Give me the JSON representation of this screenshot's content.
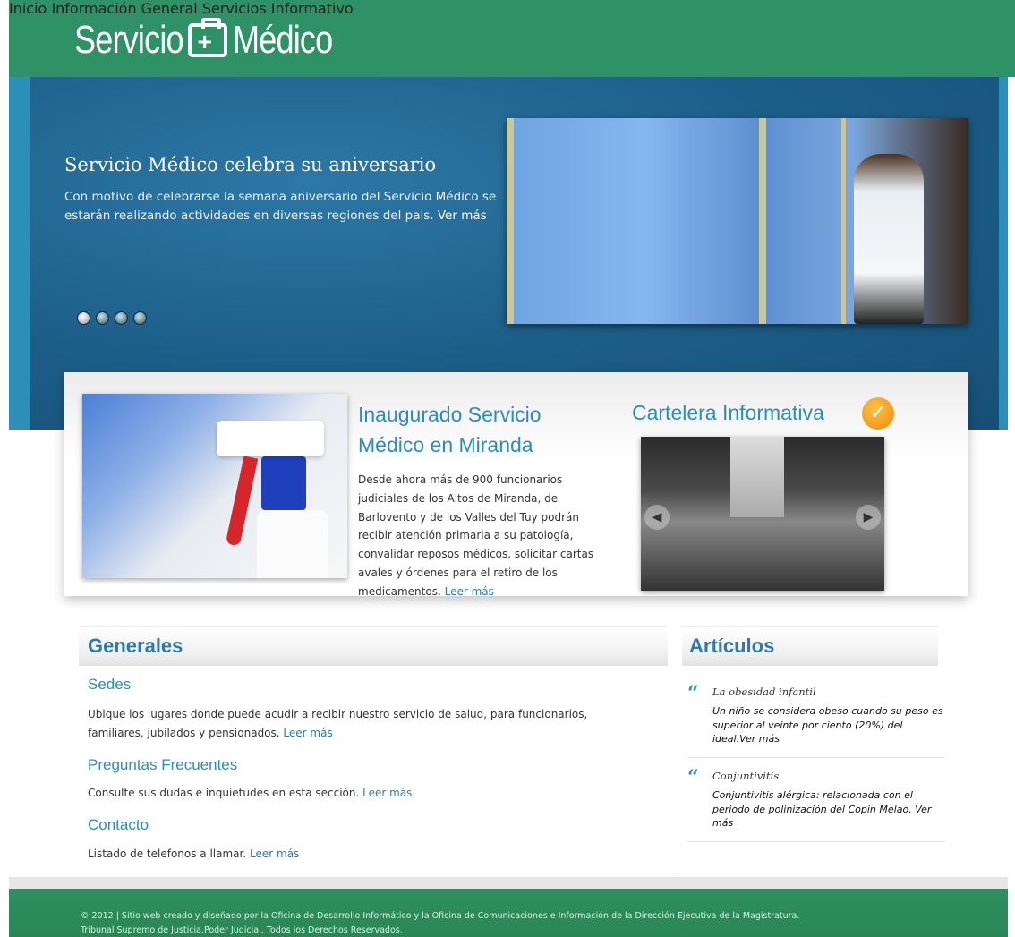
{
  "header": {
    "logo_part1": "Servicio",
    "logo_part2": "Médico",
    "nav": [
      "Inicio",
      "Información General",
      "Servicios",
      "Informativo"
    ]
  },
  "hero": {
    "title": "Servicio Médico celebra su aniversario",
    "text": "Con motivo de celebrarse la semana aniversario del Servicio Médico se estarán realizando actividades en diversas regiones del pais.",
    "more": "Ver más",
    "slides": 4,
    "active_slide": 1
  },
  "featured": {
    "title": "Inaugurado Servicio Médico en Miranda",
    "text": "Desde ahora más de 900 funcionarios judiciales de los Altos de Miranda, de Barlovento y de los Valles del Tuy podrán recibir atención primaria a su patología, convalidar reposos médicos, solicitar cartas avales y órdenes para el retiro de los medicamentos.",
    "more": "Leer más"
  },
  "cartelera": {
    "title": "Cartelera Informativa"
  },
  "generales": {
    "title": "Generales",
    "items": [
      {
        "title": "Sedes",
        "text": "Ubique los lugares donde puede acudir a recibir nuestro servicio de salud, para funcionarios, familiares, jubilados y pensionados.",
        "more": "Leer más"
      },
      {
        "title": "Preguntas Frecuentes",
        "text": "Consulte sus dudas e inquietudes en esta sección.",
        "more": "Leer más"
      },
      {
        "title": "Contacto",
        "text": "Listado de telefonos a llamar.",
        "more": "Leer más"
      }
    ]
  },
  "articulos": {
    "title": "Artículos",
    "items": [
      {
        "title": "La obesidad infantil",
        "text": "Un niño se considera obeso cuando su peso es superior al veinte por ciento (20%) del ideal.",
        "more": "Ver más"
      },
      {
        "title": "Conjuntivitis",
        "text": "Conjuntivitis alérgica: relacionada con el periodo de polinización del Copin Melao.",
        "more": "Ver más"
      }
    ]
  },
  "footer": {
    "line1": "© 2012 | Sitio web creado y diseñado por la Oficina de Desarrollo Informático y la Oficina de Comunicaciones e Información de la Dirección Ejecutiva de la Magistratura.",
    "line2": "Tribunal Supremo de Justicia.Poder Judicial. Todos los Derechos Reservados."
  },
  "colors": {
    "header_green": "#2f9266",
    "hero_blue": "#1d5f8a",
    "title_blue": "#2a8dc0",
    "link_blue": "#2a7ab5",
    "badge_orange": "#f49a1a"
  },
  "icons": [
    "medical-kit-icon",
    "check-badge-icon",
    "arrow-left-icon",
    "arrow-right-icon",
    "quote-icon"
  ]
}
